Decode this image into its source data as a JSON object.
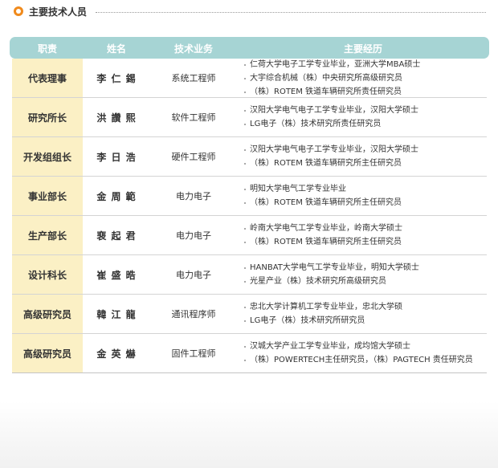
{
  "section": {
    "title": "主要技术人员"
  },
  "table": {
    "headers": {
      "title": "职责",
      "name": "姓名",
      "job": "技术业务",
      "career": "主要经历"
    },
    "rows": [
      {
        "title": "代表理事",
        "name": "李 仁 錫",
        "job": "系统工程师",
        "career": [
          "仁荷大学电子工学专业毕业，亚洲大学MBA硕士",
          "大宇综合机械（株）中央研究所高级研究员",
          "（株）ROTEM 铁道车辆研究所责任研究员"
        ]
      },
      {
        "title": "研究所长",
        "name": "洪 讚 熙",
        "job": "软件工程师",
        "career": [
          "汉阳大学电气电子工学专业毕业，汉阳大学硕士",
          "LG电子（株）技术研究所责任研究员"
        ]
      },
      {
        "title": "开发组组长",
        "name": "李 日 浩",
        "job": "硬件工程师",
        "career": [
          "汉阳大学电气电子工学专业毕业，汉阳大学硕士",
          "（株）ROTEM 铁道车辆研究所主任研究员"
        ]
      },
      {
        "title": "事业部长",
        "name": "金 周 範",
        "job": "电力电子",
        "career": [
          "明知大学电气工学专业毕业",
          "（株）ROTEM 铁道车辆研究所主任研究员"
        ]
      },
      {
        "title": "生产部长",
        "name": "裵 起 君",
        "job": "电力电子",
        "career": [
          "岭南大学电气工学专业毕业，岭南大学硕士",
          "（株）ROTEM 铁道车辆研究所主任研究员"
        ]
      },
      {
        "title": "设计科长",
        "name": "崔 盛 晧",
        "job": "电力电子",
        "career": [
          "HANBAT大学电气工学专业毕业，明知大学硕士",
          "光星产业（株）技术研究所高级研究员"
        ]
      },
      {
        "title": "高级研究员",
        "name": "韓 江 龍",
        "job": "通讯程序师",
        "career": [
          "忠北大学计算机工学专业毕业，忠北大学硕",
          "LG电子（株）技术研究所研究员"
        ]
      },
      {
        "title": "高级研究员",
        "name": "金 英 爀",
        "job": "固件工程师",
        "career": [
          "汉城大学产业工学专业毕业，成均馆大学硕士",
          "（株）POWERTECH主任研究员，（株）PAGTECH 责任研究员"
        ]
      }
    ]
  }
}
